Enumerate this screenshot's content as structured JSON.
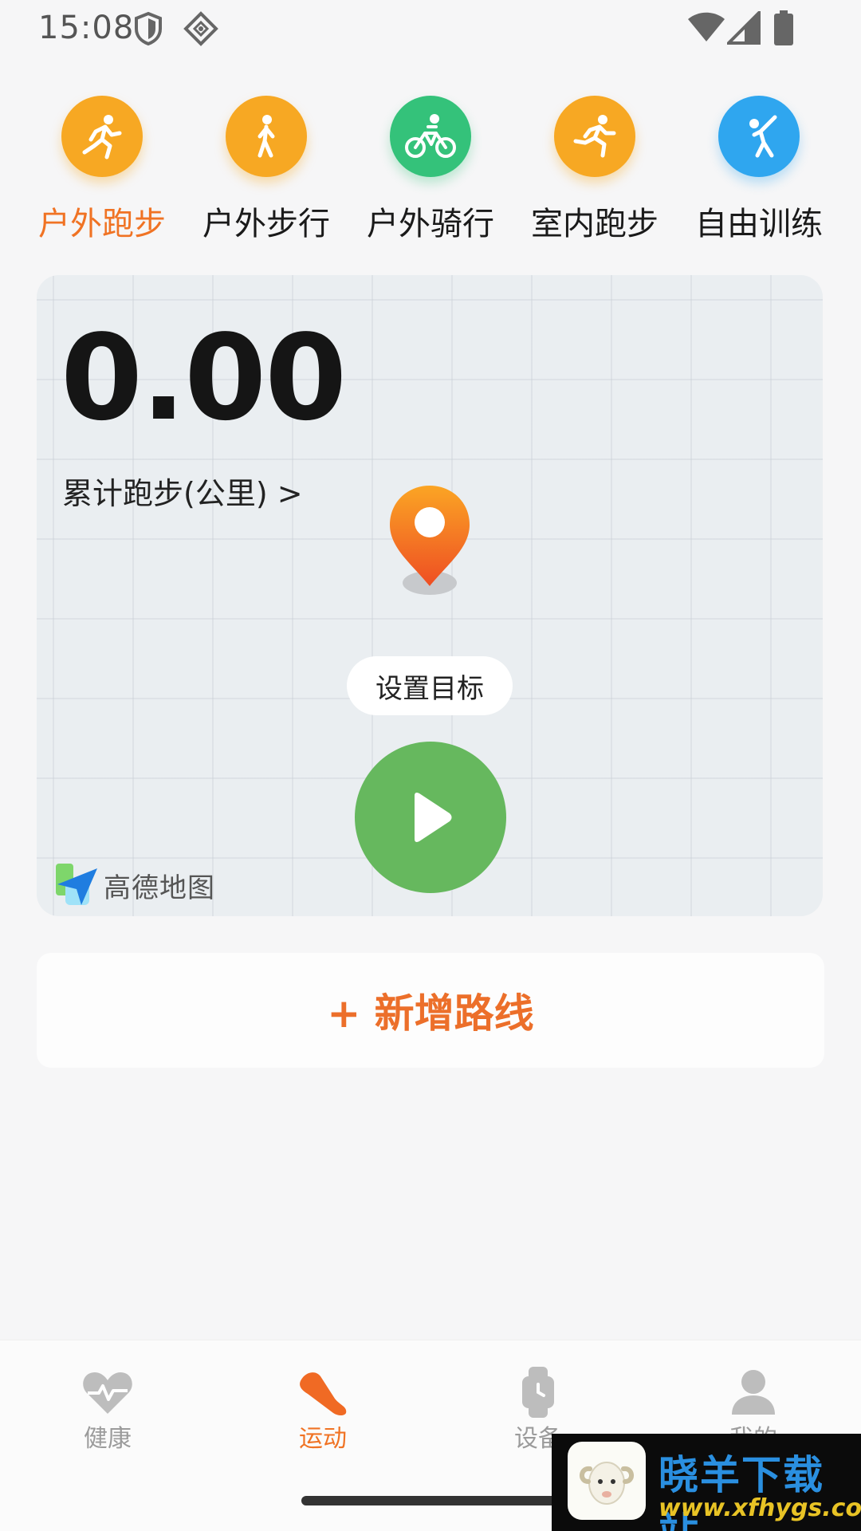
{
  "status_bar": {
    "time": "15:08",
    "left_icons": [
      "shield-icon",
      "diamond-grid-icon"
    ],
    "right_icons": [
      "wifi-icon",
      "cellular-signal-icon",
      "battery-icon"
    ]
  },
  "sport_types": [
    {
      "label": "户外跑步",
      "icon": "running-icon",
      "color": "#f7a823",
      "active": true
    },
    {
      "label": "户外步行",
      "icon": "walking-icon",
      "color": "#f7a823",
      "active": false
    },
    {
      "label": "户外骑行",
      "icon": "cycling-icon",
      "color": "#34c27a",
      "active": false
    },
    {
      "label": "室内跑步",
      "icon": "indoor-running-icon",
      "color": "#f7a823",
      "active": false
    },
    {
      "label": "自由训练",
      "icon": "free-training-icon",
      "color": "#2fa6ef",
      "active": false
    }
  ],
  "map_card": {
    "total_value": "0.00",
    "total_label": "累计跑步(公里) >",
    "goal_button": "设置目标",
    "start_button_icon": "play-icon",
    "map_provider": "高德地图"
  },
  "add_route": {
    "label": "+ 新增路线"
  },
  "bottom_nav": [
    {
      "label": "健康",
      "icon": "heart-pulse-icon",
      "active": false
    },
    {
      "label": "运动",
      "icon": "shoe-icon",
      "active": true
    },
    {
      "label": "设备",
      "icon": "watch-icon",
      "active": false
    },
    {
      "label": "我的",
      "icon": "person-icon",
      "active": false
    }
  ],
  "watermark": {
    "title": "晓羊下载站",
    "url": "www.xfhygs.com"
  },
  "colors": {
    "accent": "#f07324",
    "start_green": "#66b85e",
    "orange_icon": "#f7a823",
    "green_icon": "#34c27a",
    "blue_icon": "#2fa6ef"
  }
}
